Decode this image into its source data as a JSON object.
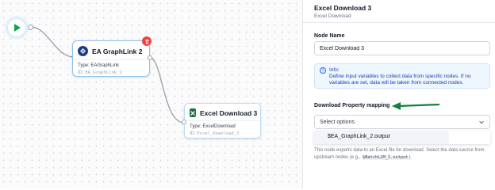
{
  "canvas": {
    "nodes": [
      {
        "title": "EA GraphLink 2",
        "type_label": "Type: EAGraphLink",
        "id_prefix": "ID: ",
        "id_value": "EA_GraphLink_2"
      },
      {
        "title": "Excel Download 3",
        "type_label": "Type: ExcelDownload",
        "id_prefix": "ID: ",
        "id_value": "Excel_Download_3"
      }
    ]
  },
  "panel": {
    "title": "Excel Download 3",
    "subtitle": "Excel Download",
    "node_name_label": "Node Name",
    "node_name_value": "Excel Download 3",
    "info_title": "Info:",
    "info_text": "Define input variables to collect data from specific nodes. If no variables are set, data will be taken from connected nodes.",
    "mapping_label": "Download Property mapping",
    "select_placeholder": "Select options",
    "dropdown_option": "$EA_GraphLink_2.output",
    "help_before": "This node exports data to an Excel file for download. Select the data source from upstream nodes (e.g.,",
    "help_code": "$BatchLLM_1.output",
    "help_after": ")."
  },
  "colors": {
    "accent": "#2563eb",
    "arrow": "#15803d",
    "delete": "#ef4444",
    "play": "#16a34a",
    "excel": "#1d6f42",
    "ea": "#1e3a8a"
  },
  "icons": [
    "play-icon",
    "ea-graphlink-icon",
    "trash-icon",
    "excel-icon",
    "info-icon",
    "chevron-down-icon"
  ]
}
